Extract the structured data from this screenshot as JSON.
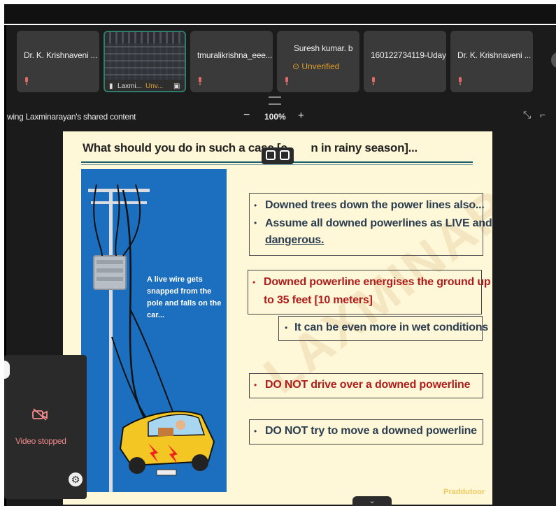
{
  "participants": [
    {
      "name": "Dr. K. Krishnaveni ..."
    },
    {
      "name": "Laxmi...",
      "status": "Unv..."
    },
    {
      "name": "tmuralikrishna_eee..."
    },
    {
      "name": "Suresh kumar. b",
      "status": "Unverified"
    },
    {
      "name": "160122734119-Uday"
    },
    {
      "name": "Dr. K. Krishnaveni ..."
    }
  ],
  "share_bar": {
    "label": "wing Laxminarayan's shared content",
    "zoom": "100%",
    "minus": "−",
    "plus": "+"
  },
  "slide": {
    "title": "What should you do in such a case [c",
    "title_rest": "n in rainy season]...",
    "caption": "A live wire gets snapped from the pole and falls on the car...",
    "watermark": "LAXMINARAYAN",
    "brand": "Praddutoor",
    "box1": {
      "line1": "Downed trees down the power lines also...",
      "line2": "Assume all downed powerlines as LIVE and",
      "line3": "dangerous."
    },
    "box2": {
      "line1": "Downed powerline energises the ground up",
      "line2": "to 35 feet [10 meters]"
    },
    "box3": {
      "line1": "It can be even more in wet conditions"
    },
    "box4": {
      "line1": "DO NOT drive over a downed powerline"
    },
    "box5": {
      "line1": "DO NOT try to move a downed powerline"
    },
    "bullet": "•"
  },
  "self_view": {
    "status": "Video stopped"
  },
  "colors": {
    "accent": "#2f7d6d",
    "alert_red": "#b01c1c",
    "illustration_blue": "#1c6fbf",
    "slide_bg": "#fef8d8"
  },
  "icons": {
    "mic": "mic-off-icon",
    "next": "chevron-right-icon",
    "camera": "camera-off-icon",
    "gear": "gear-icon",
    "expand": "expand-icon",
    "collapse": "chevron-down-icon"
  }
}
